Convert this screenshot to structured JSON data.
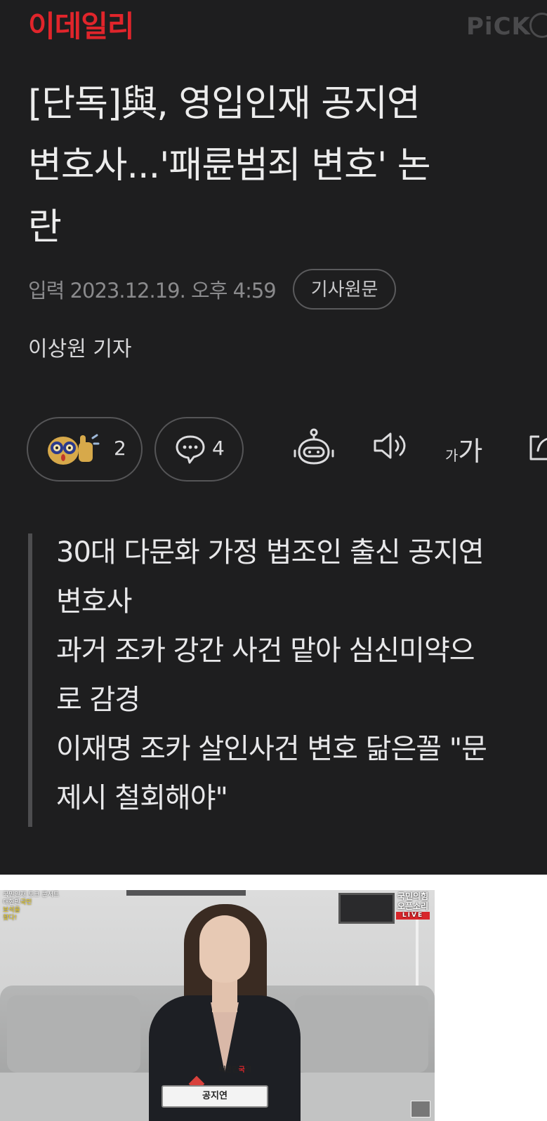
{
  "header": {
    "logo": "이데일리",
    "pick_label": "PiCK"
  },
  "article": {
    "headline": "[단독]與, 영입인재 공지연\n변호사...'패륜범죄 변호' 논\n란",
    "published": "입력 2023.12.19. 오후 4:59",
    "original_button": "기사원문",
    "reporter": "이상원 기자"
  },
  "actions": {
    "reaction_count": "2",
    "comment_count": "4",
    "font_size_small": "가",
    "font_size_big": "가"
  },
  "summary": {
    "lines": [
      "30대 다문화 가정 법조인 출신 공지연",
      "변호사",
      "과거 조카 강간 사건 맡아 심신미약으",
      "로 감경",
      "이재명 조카 살인사건 변호 닮은꼴 \"문",
      "제시 철회해야\""
    ]
  },
  "photo": {
    "top_left_line1": "국민인재 토크 콘서트",
    "top_left_line2_a": "대한민",
    "top_left_line2_b": "국민",
    "top_left_line3": "보석을",
    "top_left_line4": "찾다!",
    "top_right_party": "국민의힘",
    "top_right_show": "오픈소리",
    "live": "LIVE",
    "caption_line1_a": "대한민",
    "caption_line1_b": "국",
    "caption_line1_c": "의",
    "caption_line2": "보석을",
    "caption_line3": "찾다!",
    "name": "공지연"
  },
  "colors": {
    "background": "#1e1e1f",
    "logo_red": "#e0252b",
    "text": "#ececec",
    "muted": "#8a8a8c"
  }
}
